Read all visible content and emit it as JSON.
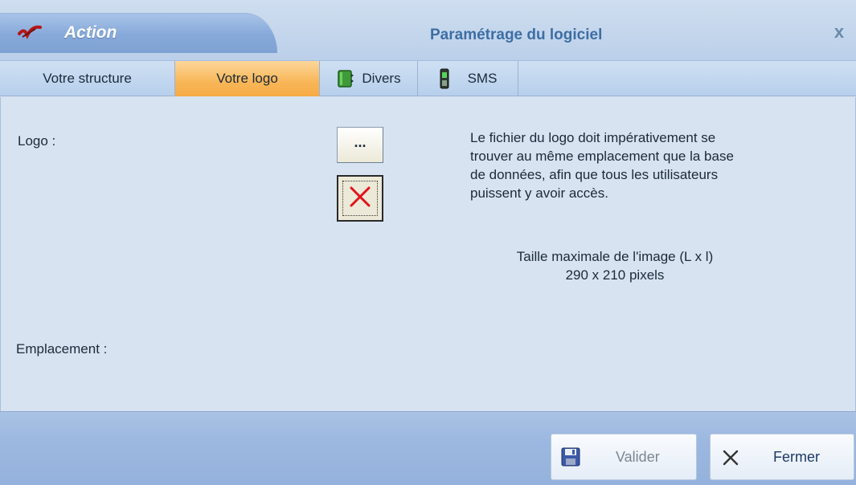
{
  "titlebar": {
    "app_name": "Action",
    "window_title": "Paramétrage du logiciel",
    "close_glyph": "x",
    "app_icon": "red-check-icon"
  },
  "tabs": [
    {
      "label": "Votre structure",
      "active": false,
      "icon": ""
    },
    {
      "label": "Votre logo",
      "active": true,
      "icon": ""
    },
    {
      "label": "Divers",
      "active": false,
      "icon": "green-book-icon"
    },
    {
      "label": "SMS",
      "active": false,
      "icon": "mobile-phone-icon"
    }
  ],
  "form": {
    "logo_label": "Logo :",
    "location_label": "Emplacement :",
    "browse_button": "...",
    "delete_icon": "red-x-icon"
  },
  "info": {
    "line1": "Le fichier du logo doit impérativement se",
    "line2": "trouver au même emplacement que la base",
    "line3": "de données, afin que tous les utilisateurs",
    "line4": "puissent y avoir accès.",
    "size_title": "Taille maximale de l'image (L x l)",
    "size_value": "290 x 210 pixels"
  },
  "footer": {
    "validate_label": "Valider",
    "validate_icon": "floppy-disk-icon",
    "validate_enabled": false,
    "close_label": "Fermer",
    "close_icon": "x-icon"
  },
  "colors": {
    "active_tab": "#f8b657",
    "content_bg": "#d7e3f0",
    "title_blue": "#3e6ea4"
  }
}
